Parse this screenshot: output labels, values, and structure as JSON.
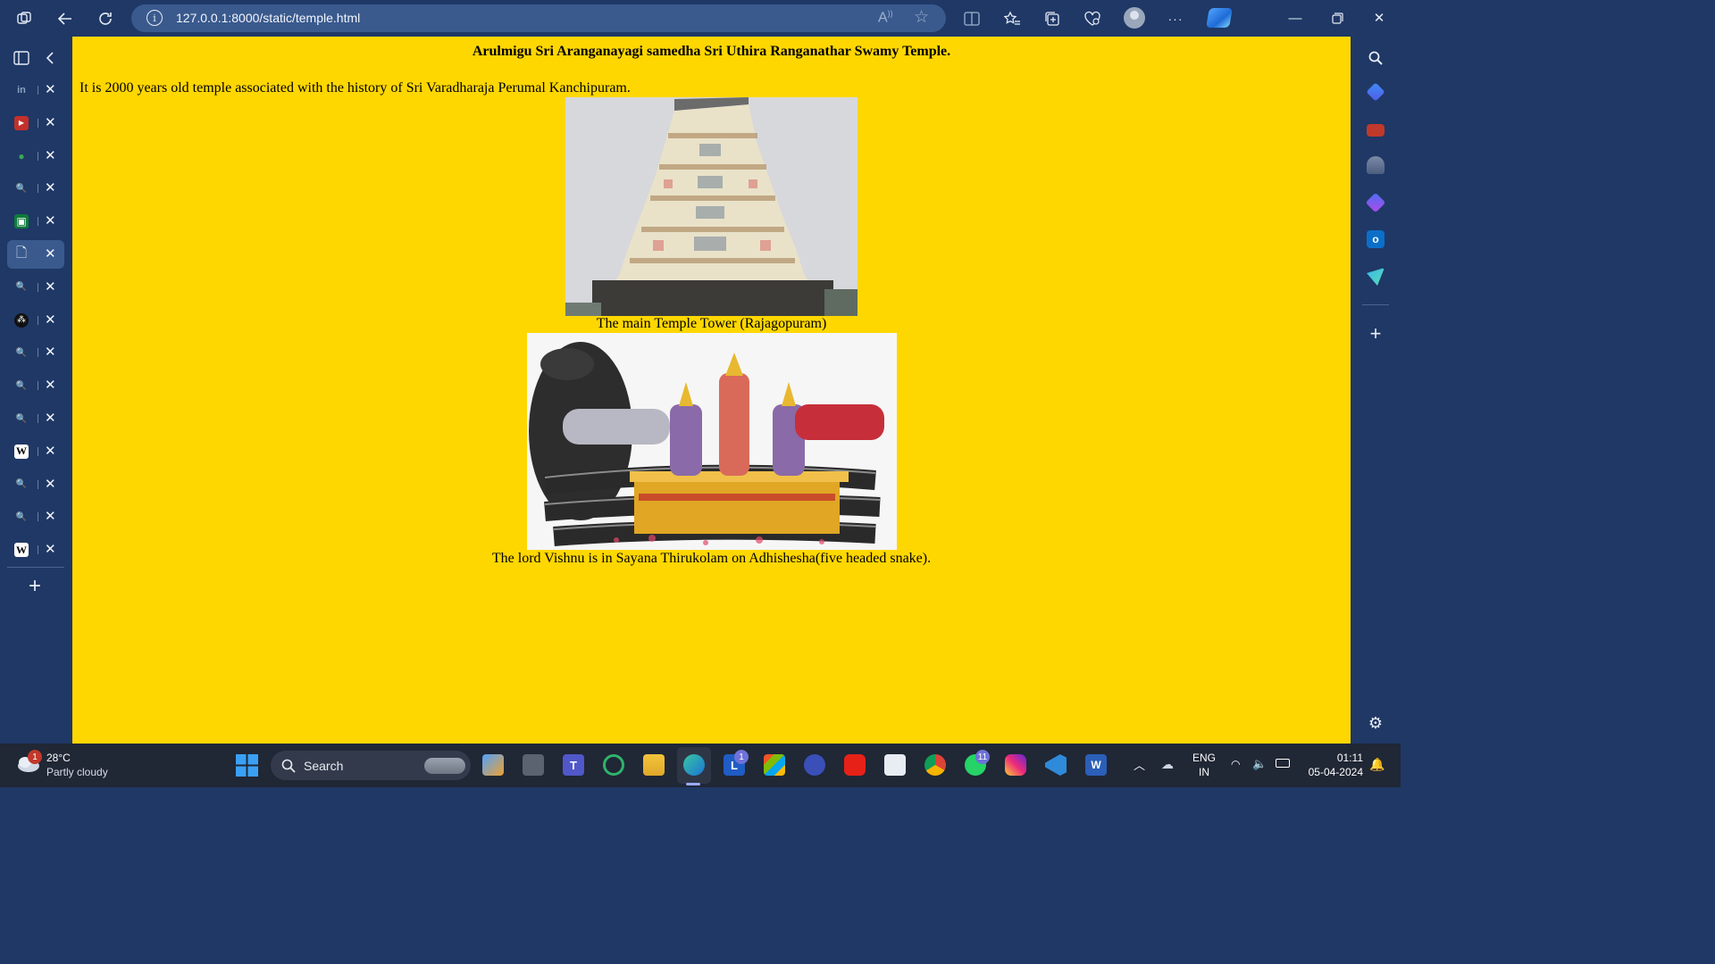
{
  "browser": {
    "url": "127.0.0.1:8000/static/temple.html",
    "tabs": [
      {
        "name": "linkedin",
        "color": "#5a6b85",
        "glyph": "in"
      },
      {
        "name": "youtube",
        "color": "#c4302b",
        "glyph": "▶"
      },
      {
        "name": "maps",
        "color": "#3aa757",
        "glyph": "●"
      },
      {
        "name": "search",
        "color": "#1f3866",
        "glyph": "🔍"
      },
      {
        "name": "image",
        "color": "#0f7b3a",
        "glyph": "▣"
      },
      {
        "name": "page",
        "color": "#1f3866",
        "glyph": "🗋",
        "active": true
      },
      {
        "name": "search",
        "color": "#1f3866",
        "glyph": "🔍"
      },
      {
        "name": "dots",
        "color": "#111",
        "glyph": "⁂"
      },
      {
        "name": "search",
        "color": "#1f3866",
        "glyph": "🔍"
      },
      {
        "name": "search",
        "color": "#1f3866",
        "glyph": "🔍"
      },
      {
        "name": "search",
        "color": "#1f3866",
        "glyph": "🔍"
      },
      {
        "name": "wikipedia",
        "color": "#ffffff",
        "glyph": "W"
      },
      {
        "name": "search",
        "color": "#1f3866",
        "glyph": "🔍"
      },
      {
        "name": "search",
        "color": "#1f3866",
        "glyph": "🔍"
      },
      {
        "name": "wikipedia",
        "color": "#ffffff",
        "glyph": "W"
      }
    ]
  },
  "page": {
    "heading": "Arulmigu Sri Aranganayagi samedha Sri Uthira Ranganathar Swamy Temple.",
    "intro": "It is 2000 years old temple associated with the history of Sri Varadharaja Perumal Kanchipuram.",
    "caption_tower": "The main Temple Tower (Rajagopuram)",
    "caption_vishnu": "The lord Vishnu is in Sayana Thirukolam on Adhishesha(five headed snake).",
    "background": "#ffd700"
  },
  "taskbar": {
    "weather_temp": "28°C",
    "weather_desc": "Partly cloudy",
    "weather_badge": "1",
    "search_label": "Search",
    "lang_top": "ENG",
    "lang_bottom": "IN",
    "time": "01:11",
    "date": "05-04-2024",
    "badge_l": "1",
    "badge_whatsapp": "11"
  }
}
